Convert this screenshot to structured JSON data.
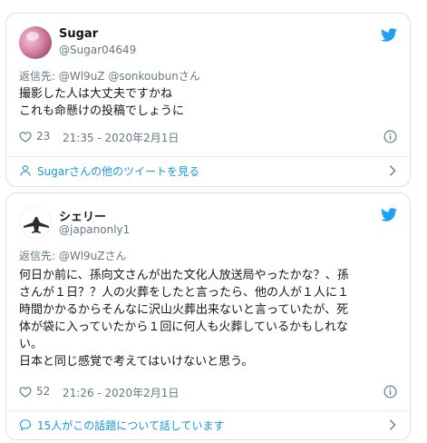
{
  "tweets": [
    {
      "author_name": "Sugar",
      "author_handle": "@Sugar04649",
      "reply_prefix": "返信先: ",
      "reply_to": "@Wl9uZ @sonkoubunさん",
      "text": "撮影した人は大丈夫ですかね\nこれも命懸けの投稿でしょうに",
      "likes": "23",
      "timestamp": "21:35 - 2020年2月1日",
      "footer_label": "Sugarさんの他のツイートを見る",
      "footer_icon": "person-icon"
    },
    {
      "author_name": "シェリー",
      "author_handle": "@japanonly1",
      "reply_prefix": "返信先: ",
      "reply_to": "@Wl9uZさん",
      "text": "何日か前に、孫向文さんが出た文化人放送局やったかな？、孫\nさんが１日？？人の火葬をしたと言ったら、他の人が１人に１\n時間かかるからそんなに沢山火葬出来ないと言っていたが、死\n体が袋に入っていたから１回に何人も火葬しているかもしれな\nい。\n日本と同じ感覚で考えてはいけないと思う。",
      "likes": "52",
      "timestamp": "21:26 - 2020年2月1日",
      "footer_label": "15人がこの話題について話しています",
      "footer_icon": "speech-bubble-icon"
    }
  ],
  "colors": {
    "twitter_blue": "#1da1f2",
    "link_blue": "#1b95e0",
    "muted_text": "#657786",
    "border": "#d9e1e6"
  }
}
